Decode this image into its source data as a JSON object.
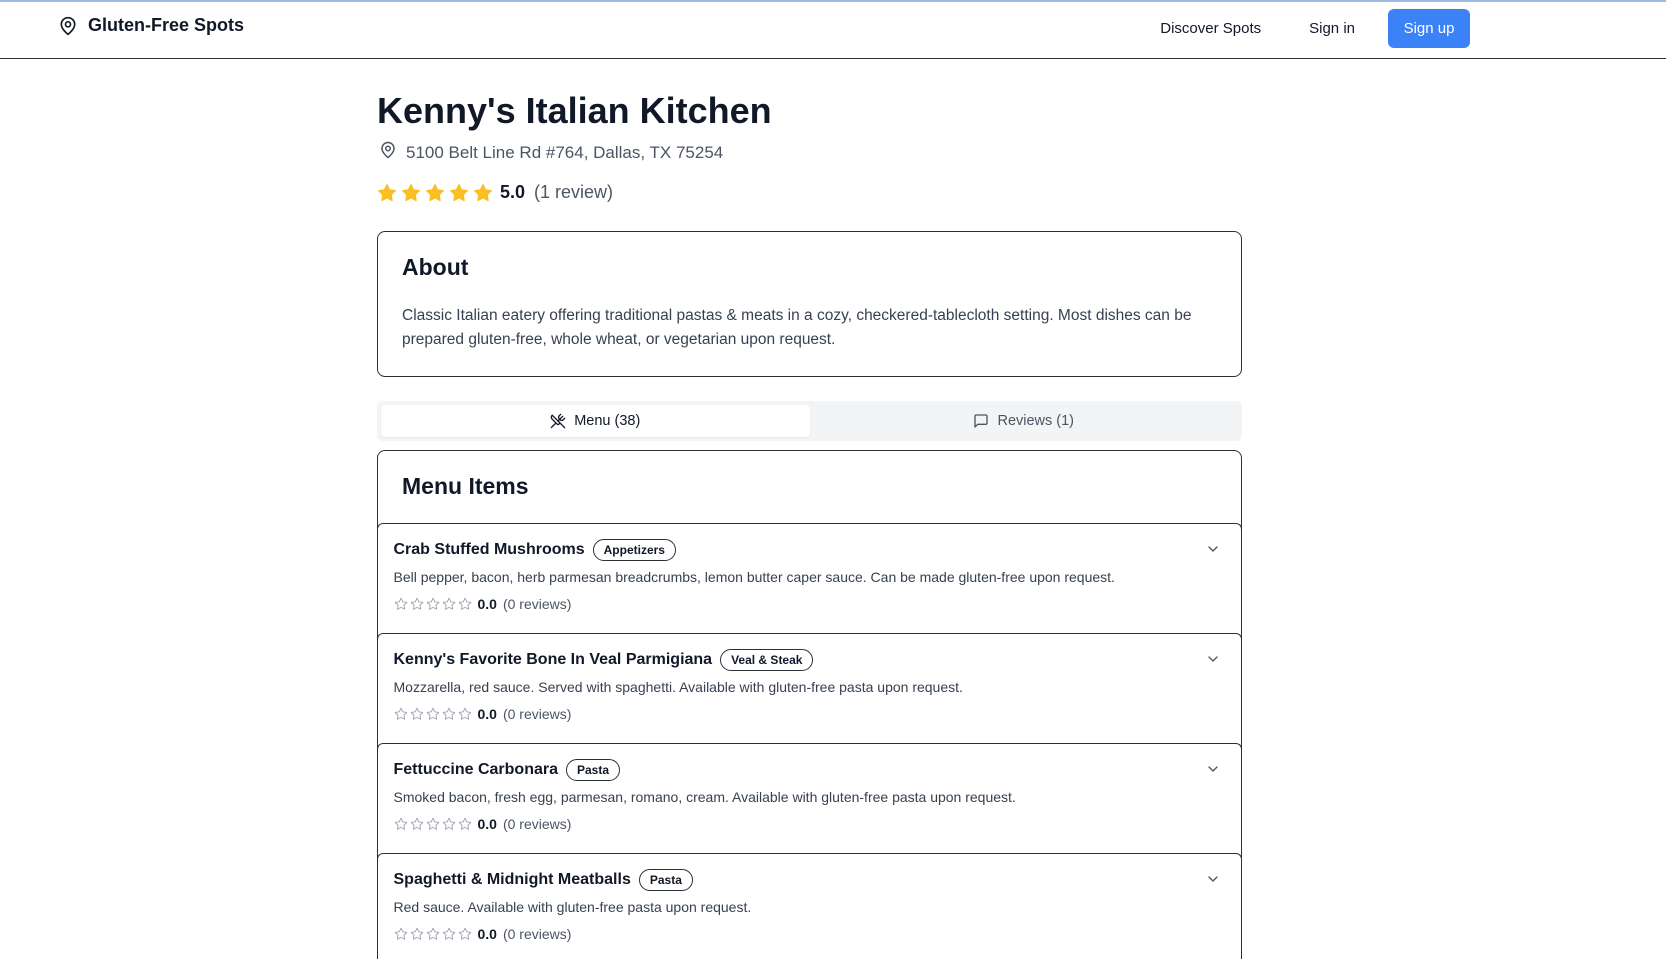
{
  "header": {
    "brand": "Gluten-Free Spots",
    "nav": {
      "discover": "Discover Spots",
      "signin": "Sign in",
      "signup": "Sign up"
    },
    "accent_color": "#3b82f6"
  },
  "restaurant": {
    "name": "Kenny's Italian Kitchen",
    "address": "5100 Belt Line Rd #764, Dallas, TX 75254",
    "rating_value": "5.0",
    "rating_count": "(1 review)",
    "stars_filled": 5,
    "star_color": "#fbbf24"
  },
  "about": {
    "title": "About",
    "text": "Classic Italian eatery offering traditional pastas & meats in a cozy, checkered-tablecloth setting. Most dishes can be prepared gluten-free, whole wheat, or vegetarian upon request."
  },
  "tabs": [
    {
      "label": "Menu (38)",
      "icon": "utensils-crossed-icon",
      "active": true
    },
    {
      "label": "Reviews (1)",
      "icon": "message-square-icon",
      "active": false
    }
  ],
  "menu": {
    "title": "Menu Items",
    "items": [
      {
        "name": "Crab Stuffed Mushrooms",
        "category": "Appetizers",
        "description": "Bell pepper, bacon, herb parmesan breadcrumbs, lemon butter caper sauce. Can be made gluten-free upon request.",
        "rating_value": "0.0",
        "rating_count": "(0 reviews)"
      },
      {
        "name": "Kenny's Favorite Bone In Veal Parmigiana",
        "category": "Veal & Steak",
        "description": "Mozzarella, red sauce. Served with spaghetti. Available with gluten-free pasta upon request.",
        "rating_value": "0.0",
        "rating_count": "(0 reviews)"
      },
      {
        "name": "Fettuccine Carbonara",
        "category": "Pasta",
        "description": "Smoked bacon, fresh egg, parmesan, romano, cream. Available with gluten-free pasta upon request.",
        "rating_value": "0.0",
        "rating_count": "(0 reviews)"
      },
      {
        "name": "Spaghetti & Midnight Meatballs",
        "category": "Pasta",
        "description": "Red sauce. Available with gluten-free pasta upon request.",
        "rating_value": "0.0",
        "rating_count": "(0 reviews)"
      }
    ]
  }
}
